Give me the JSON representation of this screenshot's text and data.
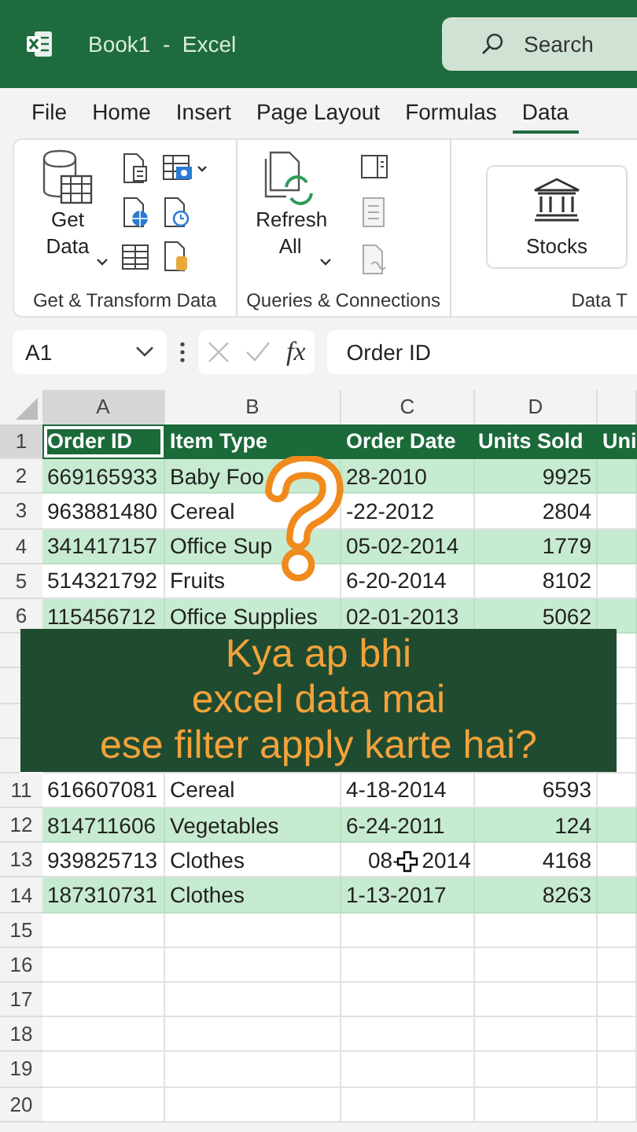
{
  "window": {
    "title": "Book1  -  Excel"
  },
  "search": {
    "placeholder": "Search"
  },
  "menu_tabs": [
    {
      "label": "File",
      "selected": false
    },
    {
      "label": "Home",
      "selected": false
    },
    {
      "label": "Insert",
      "selected": false
    },
    {
      "label": "Page Layout",
      "selected": false
    },
    {
      "label": "Formulas",
      "selected": false
    },
    {
      "label": "Data",
      "selected": true
    }
  ],
  "ribbon": {
    "groups": [
      {
        "label": "Get & Transform Data",
        "kind": "get"
      },
      {
        "label": "Queries & Connections",
        "kind": "queries"
      },
      {
        "label": "Data T",
        "kind": "types"
      }
    ],
    "get_data": "Get Data",
    "refresh_all": "Refresh All",
    "stocks": "Stocks"
  },
  "formula_bar": {
    "name_box": "A1",
    "fx": "fx",
    "value": "Order ID"
  },
  "sheet": {
    "columns": [
      {
        "label": "A",
        "selected": true
      },
      {
        "label": "B",
        "selected": false
      },
      {
        "label": "C",
        "selected": false
      },
      {
        "label": "D",
        "selected": false
      }
    ],
    "rows": [
      {
        "number": "1",
        "kind": "header",
        "selected": true,
        "cells": [
          "Order ID",
          "Item Type",
          "Order Date",
          "Units Sold",
          "Uni"
        ]
      },
      {
        "number": "2",
        "kind": "data",
        "shaded": true,
        "cells": [
          "669165933",
          "Baby Foo",
          "28-2010",
          "9925"
        ]
      },
      {
        "number": "3",
        "kind": "data",
        "shaded": false,
        "cells": [
          "963881480",
          "Cereal",
          "-22-2012",
          "2804"
        ]
      },
      {
        "number": "4",
        "kind": "data",
        "shaded": true,
        "cells": [
          "341417157",
          "Office Sup",
          "05-02-2014",
          "1779"
        ]
      },
      {
        "number": "5",
        "kind": "data",
        "shaded": false,
        "cells": [
          "514321792",
          "Fruits",
          "6-20-2014",
          "8102"
        ]
      },
      {
        "number": "6",
        "kind": "data",
        "shaded": true,
        "cells": [
          "115456712",
          "Office Supplies",
          "02-01-2013",
          "5062"
        ]
      },
      {
        "kind": "covered"
      },
      {
        "kind": "covered"
      },
      {
        "kind": "covered"
      },
      {
        "kind": "covered"
      },
      {
        "number": "11",
        "kind": "data",
        "shaded": false,
        "cells": [
          "616607081",
          "Cereal",
          "4-18-2014",
          "6593"
        ]
      },
      {
        "number": "12",
        "kind": "data",
        "shaded": true,
        "cells": [
          "814711606",
          "Vegetables",
          "6-24-2011",
          "124"
        ]
      },
      {
        "number": "13",
        "kind": "data",
        "shaded": false,
        "cells": [
          "939825713",
          "Clothes",
          {
            "before": "08-",
            "after": "2014"
          },
          "4168"
        ]
      },
      {
        "number": "14",
        "kind": "data",
        "shaded": true,
        "cells": [
          "187310731",
          "Clothes",
          "1-13-2017",
          "8263"
        ]
      },
      {
        "number": "15",
        "kind": "empty"
      },
      {
        "number": "16",
        "kind": "empty"
      },
      {
        "number": "17",
        "kind": "empty"
      },
      {
        "number": "18",
        "kind": "empty"
      },
      {
        "number": "19",
        "kind": "empty"
      },
      {
        "number": "20",
        "kind": "empty"
      }
    ]
  },
  "caption": {
    "lines": [
      "Kya ap bhi",
      "excel data mai",
      "ese filter apply karte hai?"
    ]
  }
}
